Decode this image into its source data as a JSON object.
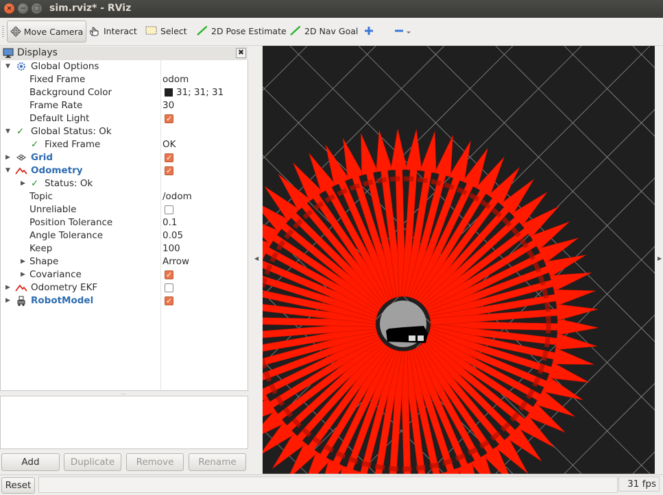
{
  "window": {
    "title": "sim.rviz* - RViz",
    "close_glyph": "×",
    "min_glyph": "−",
    "max_glyph": "□"
  },
  "toolbar": {
    "move_camera": "Move Camera",
    "interact": "Interact",
    "select": "Select",
    "pose_estimate": "2D Pose Estimate",
    "nav_goal": "2D Nav Goal"
  },
  "displays": {
    "title": "Displays",
    "rows": [
      {
        "label": "Global Options",
        "value": ""
      },
      {
        "label": "Fixed Frame",
        "value": "odom"
      },
      {
        "label": "Background Color",
        "value": "31; 31; 31"
      },
      {
        "label": "Frame Rate",
        "value": "30"
      },
      {
        "label": "Default Light",
        "value": ""
      },
      {
        "label": "Global Status: Ok",
        "value": ""
      },
      {
        "label": "Fixed Frame",
        "value": "OK"
      },
      {
        "label": "Grid",
        "value": ""
      },
      {
        "label": "Odometry",
        "value": ""
      },
      {
        "label": "Status: Ok",
        "value": ""
      },
      {
        "label": "Topic",
        "value": "/odom"
      },
      {
        "label": "Unreliable",
        "value": ""
      },
      {
        "label": "Position Tolerance",
        "value": "0.1"
      },
      {
        "label": "Angle Tolerance",
        "value": "0.05"
      },
      {
        "label": "Keep",
        "value": "100"
      },
      {
        "label": "Shape",
        "value": "Arrow"
      },
      {
        "label": "Covariance",
        "value": ""
      },
      {
        "label": "Odometry EKF",
        "value": ""
      },
      {
        "label": "RobotModel",
        "value": ""
      }
    ],
    "checks": {
      "default_light": true,
      "grid": true,
      "odometry": true,
      "unreliable": false,
      "covariance": true,
      "odometry_ekf": false,
      "robotmodel": true
    },
    "background_color_swatch": "#1f1f1f"
  },
  "buttons": {
    "add": "Add",
    "duplicate": "Duplicate",
    "remove": "Remove",
    "rename": "Rename"
  },
  "statusbar": {
    "reset": "Reset",
    "fps": "31 fps"
  },
  "viewport": {
    "background": "#1f1f1f",
    "arrow_color": "#ff1a00",
    "grid_color": "#8c8c8c",
    "covariance_color": "#a0a0a0"
  }
}
